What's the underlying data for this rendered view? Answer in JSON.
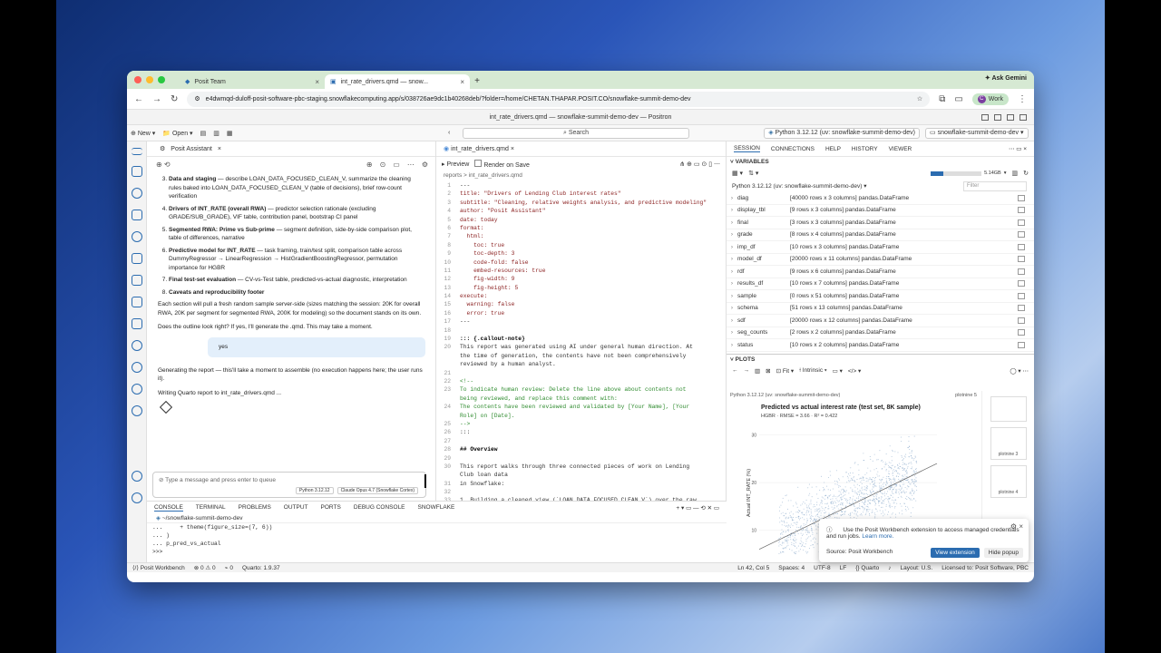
{
  "browser": {
    "tabs": [
      {
        "label": "Posit Team"
      },
      {
        "label": "int_rate_drivers.qmd — snow..."
      }
    ],
    "ask_gemini": "Ask Gemini",
    "url": "e4dwmqd-duloff-posit-software-pbc-staging.snowflakecomputing.app/s/038726ae9dc1b40268deb/?folder=/home/CHETAN.THAPAR.POSIT.CO/snowflake-summit-demo-dev",
    "profile": "Work",
    "profile_initial": "C"
  },
  "positron": {
    "title": "int_rate_drivers.qmd — snowflake-summit-demo-dev — Positron",
    "new_label": "New",
    "open_label": "Open",
    "search": "Search",
    "python_runtime": "Python 3.12.12 (uv: snowflake-summit-demo-dev)",
    "project": "snowflake-summit-demo-dev"
  },
  "assistant": {
    "tab": "Posit Assistant",
    "items": [
      {
        "head": "Data and staging",
        "body": " — describe LOAN_DATA_FOCUSED_CLEAN_V, summarize the cleaning rules baked into LOAN_DATA_FOCUSED_CLEAN_V (table of decisions), brief row-count verification"
      },
      {
        "head": "Drivers of INT_RATE (overall RWA)",
        "body": " — predictor selection rationale (excluding GRADE/SUB_GRADE), VIF table, contribution panel, bootstrap CI panel"
      },
      {
        "head": "Segmented RWA: Prime vs Sub-prime",
        "body": " — segment definition, side-by-side comparison plot, table of differences, narrative"
      },
      {
        "head": "Predictive model for INT_RATE",
        "body": " — task framing, train/test split, comparison table across DummyRegressor → LinearRegression → HistGradientBoostingRegressor, permutation importance for HGBR"
      },
      {
        "head": "Final test-set evaluation",
        "body": " — CV-vs-Test table, predicted-vs-actual diagnostic, interpretation"
      },
      {
        "head": "Caveats and reproducibility footer",
        "body": ""
      }
    ],
    "para1": "Each section will pull a fresh random sample server-side (sizes matching the session: 20K for overall RWA, 20K per segment for segmented RWA, 200K for modeling) so the document stands on its own.",
    "para2": "Does the outline look right? If yes, I'll generate the .qmd. This may take a moment.",
    "user_reply": "yes",
    "para3": "Generating the report — this'll take a moment to assemble (no execution happens here; the user runs it).",
    "para4": "Writing Quarto report to int_rate_drivers.qmd ...",
    "input_placeholder": "Type a message and press enter to queue",
    "chip_python": "Python 3.12.12",
    "chip_model": "Claude Opus 4.7 (Snowflake Cortex)"
  },
  "editor": {
    "tab": "int_rate_drivers.qmd",
    "preview": "Preview",
    "render_on_save": "Render on Save",
    "breadcrumb": "reports  >  int_rate_drivers.qmd",
    "lines": [
      {
        "n": "1",
        "t": "---"
      },
      {
        "n": "2",
        "t": "title: \"Drivers of Lending Club interest rates\""
      },
      {
        "n": "3",
        "t": "subtitle: \"Cleaning, relative weights analysis, and predictive modeling\""
      },
      {
        "n": "4",
        "t": "author: \"Posit Assistant\""
      },
      {
        "n": "5",
        "t": "date: today"
      },
      {
        "n": "6",
        "t": "format:"
      },
      {
        "n": "7",
        "t": "  html:"
      },
      {
        "n": "8",
        "t": "    toc: true"
      },
      {
        "n": "9",
        "t": "    toc-depth: 3"
      },
      {
        "n": "10",
        "t": "    code-fold: false"
      },
      {
        "n": "11",
        "t": "    embed-resources: true"
      },
      {
        "n": "12",
        "t": "    fig-width: 9"
      },
      {
        "n": "13",
        "t": "    fig-height: 5"
      },
      {
        "n": "14",
        "t": "execute:"
      },
      {
        "n": "15",
        "t": "  warning: false"
      },
      {
        "n": "16",
        "t": "  error: true"
      },
      {
        "n": "17",
        "t": "---"
      },
      {
        "n": "18",
        "t": ""
      },
      {
        "n": "19",
        "t": "::: {.callout-note}"
      },
      {
        "n": "20",
        "t": "This report was generated using AI under general human direction. At"
      },
      {
        "n": "",
        "t": "the time of generation, the contents have not been comprehensively"
      },
      {
        "n": "",
        "t": "reviewed by a human analyst."
      },
      {
        "n": "21",
        "t": ""
      },
      {
        "n": "22",
        "t": "<!--"
      },
      {
        "n": "23",
        "t": "To indicate human review: Delete the line above about contents not"
      },
      {
        "n": "",
        "t": "being reviewed, and replace this comment with:"
      },
      {
        "n": "24",
        "t": "The contents have been reviewed and validated by [Your Name], [Your"
      },
      {
        "n": "",
        "t": "Role] on [Date]."
      },
      {
        "n": "25",
        "t": "-->"
      },
      {
        "n": "26",
        "t": ":::"
      },
      {
        "n": "27",
        "t": ""
      },
      {
        "n": "28",
        "t": "## Overview"
      },
      {
        "n": "29",
        "t": ""
      },
      {
        "n": "30",
        "t": "This report walks through three connected pieces of work on Lending"
      },
      {
        "n": "",
        "t": "Club loan data"
      },
      {
        "n": "31",
        "t": "in Snowflake:"
      },
      {
        "n": "32",
        "t": ""
      },
      {
        "n": "33",
        "t": "1. Building a cleaned view (`LOAN_DATA_FOCUSED_CLEAN_V`) over the raw"
      }
    ]
  },
  "session": {
    "tabs": [
      "SESSION",
      "CONNECTIONS",
      "HELP",
      "HISTORY",
      "VIEWER"
    ],
    "variables_label": "VARIABLES",
    "memory": "5.14GB",
    "memory_fraction": 0.25,
    "runtime": "Python 3.12.12 (uv: snowflake-summit-demo-dev)",
    "filter_placeholder": "Filter",
    "variables": [
      {
        "name": "diag",
        "value": "[40000 rows x 3 columns] pandas.DataFrame"
      },
      {
        "name": "display_tbl",
        "value": "[9 rows x 3 columns] pandas.DataFrame"
      },
      {
        "name": "final",
        "value": "[3 rows x 3 columns] pandas.DataFrame"
      },
      {
        "name": "grade",
        "value": "[8 rows x 4 columns] pandas.DataFrame"
      },
      {
        "name": "imp_df",
        "value": "[10 rows x 3 columns] pandas.DataFrame"
      },
      {
        "name": "model_df",
        "value": "[20000 rows x 11 columns] pandas.DataFrame"
      },
      {
        "name": "rdf",
        "value": "[9 rows x 6 columns] pandas.DataFrame"
      },
      {
        "name": "results_df",
        "value": "[10 rows x 7 columns] pandas.DataFrame"
      },
      {
        "name": "sample",
        "value": "[0 rows x 51 columns] pandas.DataFrame"
      },
      {
        "name": "schema",
        "value": "[51 rows x 13 columns] pandas.DataFrame"
      },
      {
        "name": "sdf",
        "value": "[20000 rows x 12 columns] pandas.DataFrame"
      },
      {
        "name": "seg_counts",
        "value": "[2 rows x 2 columns] pandas.DataFrame"
      },
      {
        "name": "status",
        "value": "[10 rows x 2 columns] pandas.DataFrame"
      }
    ],
    "plots_label": "PLOTS",
    "fit": "Fit",
    "intrinsic": "Intrinsic",
    "plot_runtime": "Python 3.12.12 (uv: snowflake-summit-demo-dev)",
    "plot_name": "plotnine 5",
    "thumbs": [
      "plotnine 3",
      "plotnine 4"
    ]
  },
  "chart_data": {
    "type": "scatter",
    "title": "Predicted vs actual interest rate (test set, 8K sample)",
    "subtitle": "HGBR · RMSE = 3.66 · R² = 0.422",
    "xlabel": "",
    "ylabel": "Actual INT_RATE (%)",
    "yticks": [
      "30",
      "20",
      "10"
    ],
    "ylim": [
      5,
      32
    ],
    "xlim": [
      6,
      24
    ],
    "reference_line": [
      [
        6,
        6
      ],
      [
        24,
        24
      ]
    ]
  },
  "popup": {
    "message": "Use the Posit Workbench extension to access managed credentials and run jobs.",
    "learn_more": "Learn more.",
    "source": "Source: Posit Workbench",
    "view": "View extension",
    "hide": "Hide popup"
  },
  "console": {
    "tabs": [
      "CONSOLE",
      "TERMINAL",
      "PROBLEMS",
      "OUTPUT",
      "PORTS",
      "DEBUG CONSOLE",
      "SNOWFLAKE"
    ],
    "path": "~/snowflake-summit-demo-dev",
    "lines": [
      "...     + theme(figure_size=(7, 6))",
      "... )",
      "... p_pred_vs_actual",
      ">>>"
    ]
  },
  "statusbar": {
    "workbench": "Posit Workbench",
    "errors": "0",
    "warnings": "0",
    "ports": "0",
    "quarto": "Quarto: 1.9.37",
    "position": "Ln 42, Col 5",
    "spaces": "Spaces: 4",
    "encoding": "UTF-8",
    "eol": "LF",
    "language": "Quarto",
    "layout": "Layout: U.S.",
    "license": "Licensed to: Posit Software, PBC"
  },
  "colors": {
    "accent": "#2b6cb0",
    "tabstrip": "#d6e9d3"
  }
}
